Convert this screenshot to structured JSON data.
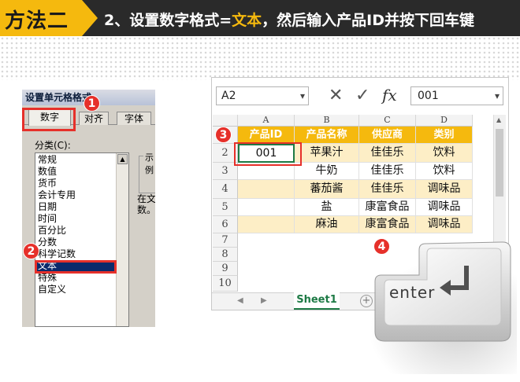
{
  "banner": {
    "method": "方法二",
    "step_prefix": "2、设置数字格式=",
    "step_highlight": "文本",
    "step_suffix": "，然后输入产品ID并按下回车键"
  },
  "badges": [
    "1",
    "2",
    "3",
    "4"
  ],
  "dialog": {
    "title": "设置单元格格式",
    "tabs": [
      "数字",
      "对齐",
      "字体"
    ],
    "category_label": "分类(C):",
    "categories": [
      "常规",
      "数值",
      "货币",
      "会计专用",
      "日期",
      "时间",
      "百分比",
      "分数",
      "科学记数",
      "文本",
      "特殊",
      "自定义"
    ],
    "selected": "文本",
    "sample_label": "示例",
    "side_text": "在文数。"
  },
  "excel": {
    "name_box": "A2",
    "formula_value": "001",
    "fx_label": "fx",
    "columns": [
      "A",
      "B",
      "C",
      "D"
    ],
    "rows": [
      "2",
      "3",
      "4",
      "5",
      "6",
      "7",
      "8",
      "9",
      "10"
    ],
    "headers": [
      "产品ID",
      "产品名称",
      "供应商",
      "类别"
    ],
    "data": [
      [
        "001",
        "苹果汁",
        "佳佳乐",
        "饮料"
      ],
      [
        "",
        "牛奶",
        "佳佳乐",
        "饮料"
      ],
      [
        "",
        "蕃茄酱",
        "佳佳乐",
        "调味品"
      ],
      [
        "",
        "盐",
        "康富食品",
        "调味品"
      ],
      [
        "",
        "麻油",
        "康富食品",
        "调味品"
      ]
    ],
    "sheet_tab": "Sheet1"
  },
  "enter_key": "enter",
  "colors": {
    "accent": "#f5b90e",
    "badge": "#e6302a",
    "banner": "#2a2a2a",
    "excel_green": "#1d7a45"
  }
}
